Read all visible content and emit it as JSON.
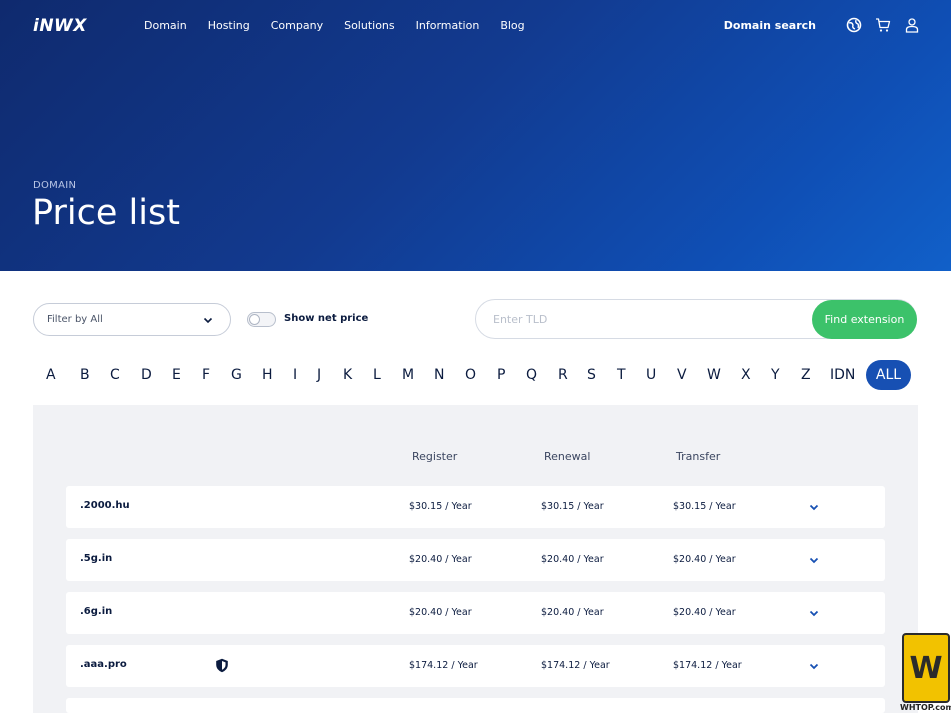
{
  "header": {
    "logo_text": "iNWX",
    "nav": [
      "Domain",
      "Hosting",
      "Company",
      "Solutions",
      "Information",
      "Blog"
    ],
    "domain_search_label": "Domain search",
    "icons": [
      "globe-icon",
      "cart-icon",
      "user-icon"
    ]
  },
  "hero": {
    "breadcrumb": "DOMAIN",
    "title": "Price list"
  },
  "filters": {
    "filter_select_value": "Filter by All",
    "toggle_label": "Show net price",
    "toggle_on": false,
    "tld_placeholder": "Enter TLD",
    "find_button_label": "Find extension"
  },
  "alphabet": {
    "letters": [
      "A",
      "B",
      "C",
      "D",
      "E",
      "F",
      "G",
      "H",
      "I",
      "J",
      "K",
      "L",
      "M",
      "N",
      "O",
      "P",
      "Q",
      "R",
      "S",
      "T",
      "U",
      "V",
      "W",
      "X",
      "Y",
      "Z",
      "IDN",
      "ALL"
    ],
    "active": "ALL"
  },
  "table": {
    "columns": [
      "Register",
      "Renewal",
      "Transfer"
    ],
    "rows": [
      {
        "tld": ".2000.hu",
        "register": "$30.15",
        "renewal": "$30.15",
        "transfer": "$30.15",
        "period": "Year",
        "has_shield": false
      },
      {
        "tld": ".5g.in",
        "register": "$20.40",
        "renewal": "$20.40",
        "transfer": "$20.40",
        "period": "Year",
        "has_shield": false
      },
      {
        "tld": ".6g.in",
        "register": "$20.40",
        "renewal": "$20.40",
        "transfer": "$20.40",
        "period": "Year",
        "has_shield": false
      },
      {
        "tld": ".aaa.pro",
        "register": "$174.12",
        "renewal": "$174.12",
        "transfer": "$174.12",
        "period": "Year",
        "has_shield": true
      }
    ],
    "separator": "/"
  },
  "watermark": {
    "mark": "W",
    "site": "WHTOP.com"
  },
  "colors": {
    "hero_dark": "#0f2a6e",
    "hero_light": "#1160c9",
    "accent_blue": "#1750b3",
    "find_green": "#3cc26a",
    "panel_bg": "#f1f2f5"
  }
}
